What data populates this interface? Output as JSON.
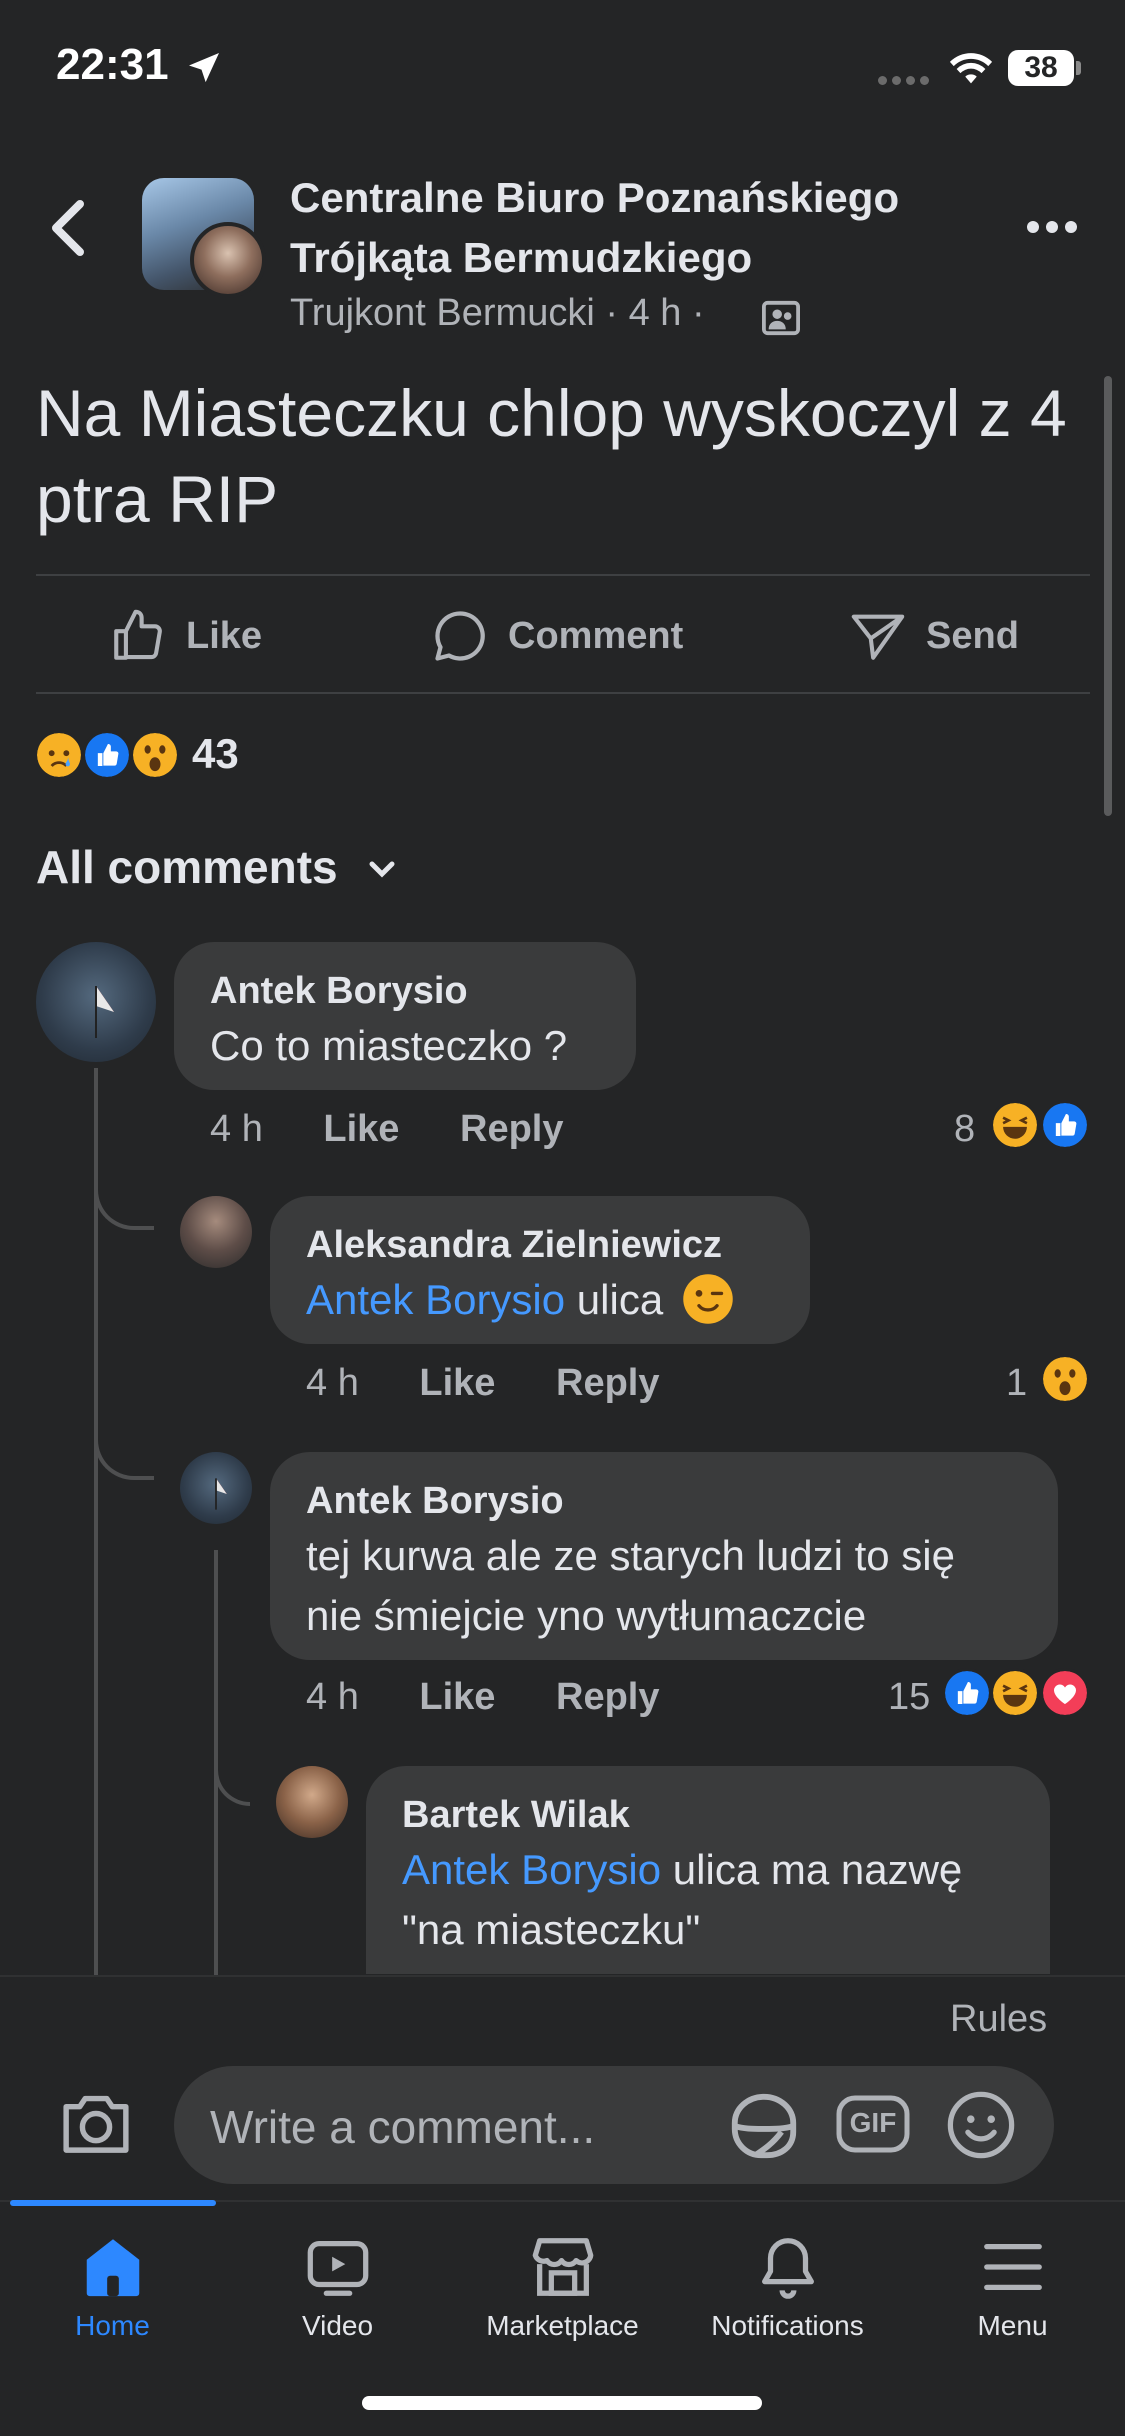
{
  "status_bar": {
    "time": "22:31",
    "battery": "38"
  },
  "header": {
    "group_name": "Centralne Biuro Poznańskiego Trójkąta Bermudzkiego",
    "author": "Trujkont Bermucki",
    "separator": "·",
    "age": "4 h"
  },
  "post": {
    "text": "Na Miasteczku chlop wyskoczyl z 4 ptra RIP",
    "actions": {
      "like": "Like",
      "comment": "Comment",
      "send": "Send"
    },
    "reaction_count": "43",
    "reactions": [
      "sad",
      "like",
      "wow"
    ]
  },
  "comments_filter": "All comments",
  "comments": [
    {
      "author": "Antek Borysio",
      "text": "Co to miasteczko ?",
      "age": "4 h",
      "like": "Like",
      "reply": "Reply",
      "reaction_count": "8",
      "reactions": [
        "haha",
        "like"
      ]
    },
    {
      "author": "Aleksandra Zielniewicz",
      "mention": "Antek Borysio",
      "text": "ulica",
      "emoji": "wink",
      "age": "4 h",
      "like": "Like",
      "reply": "Reply",
      "reaction_count": "1",
      "reactions": [
        "wow"
      ]
    },
    {
      "author": "Antek Borysio",
      "text_line1": "tej kurwa ale ze starych ludzi to się",
      "text_line2": "nie śmiejcie yno wytłumaczcie",
      "age": "4 h",
      "like": "Like",
      "reply": "Reply",
      "reaction_count": "15",
      "reactions": [
        "like",
        "haha",
        "love"
      ]
    },
    {
      "author": "Bartek Wilak",
      "mention": "Antek Borysio",
      "text_line1": "ulica ma nazwę",
      "text_line2": "\"na miasteczku\""
    }
  ],
  "composer": {
    "rules": "Rules",
    "placeholder": "Write a comment...",
    "gif": "GIF"
  },
  "tabs": [
    {
      "label": "Home",
      "active": true
    },
    {
      "label": "Video"
    },
    {
      "label": "Marketplace"
    },
    {
      "label": "Notifications"
    },
    {
      "label": "Menu"
    }
  ],
  "colors": {
    "accent": "#2d88ff",
    "mention": "#4599ff",
    "background": "#242526",
    "bubble": "#3a3b3c"
  }
}
